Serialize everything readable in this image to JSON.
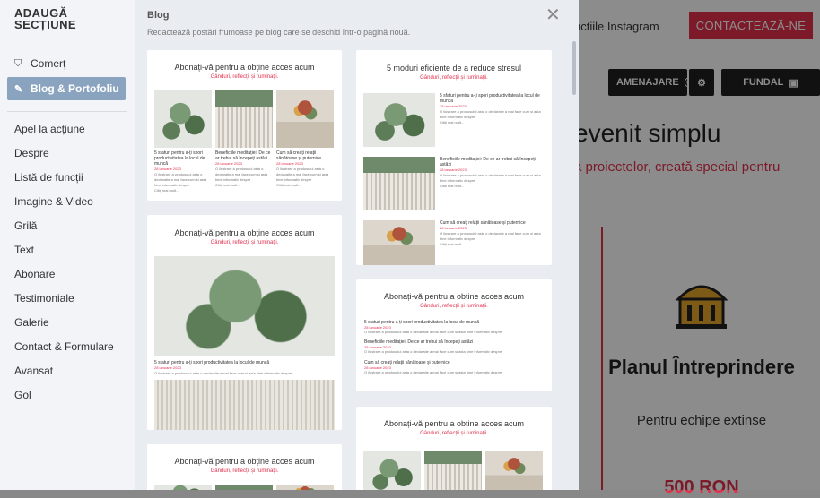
{
  "background": {
    "instagram_text": "nctiile Instagram",
    "contact_button": "CONTACTEAZĂ-NE",
    "amenajare_button": "AMENAJARE",
    "fundal_button": "FUNDAL",
    "headline": "evenit simplu",
    "subheadline": "a proiectelor, creată special pentru",
    "plan_title": "Planul Întreprindere",
    "plan_subtitle": "Pentru echipe extinse",
    "price": "500 RON",
    "accent_color": "#e2304c"
  },
  "nav": {
    "title": "ADAUGĂ SECȚIUNE",
    "top_items": [
      {
        "label": "Comerț",
        "icon": "shop-bag-icon"
      },
      {
        "label": "Blog & Portofoliu",
        "icon": "edit-icon",
        "active": true
      }
    ],
    "items": [
      "Apel la acțiune",
      "Despre",
      "Listă de funcții",
      "Imagine & Video",
      "Grilă",
      "Text",
      "Abonare",
      "Testimoniale",
      "Galerie",
      "Contact & Formulare",
      "Avansat",
      "Gol"
    ]
  },
  "panel": {
    "title": "Blog",
    "description": "Redactează postări frumoase pe blog care se deschid într-o pagină nouă.",
    "card_heading": "Abonați-vă pentru a obține acces acum",
    "card_sub": "Gânduri, reflecții și ruminații.",
    "card2_heading": "5 moduri eficiente de a reduce stresul",
    "posts": [
      "5 sfaturi pentru a-ți spori productivitatea la locul de muncă",
      "Beneficiile meditației: De ce ar trebui să începeți astăzi",
      "Cum să creați relații sănătoase și puternice"
    ],
    "post_date": "28 ianuarie 2023",
    "post_text": "O ilustrare a produsului asta o declaratie a mai face cum si asta bine informativ despre",
    "read_more": "Citiți mai mult..."
  }
}
